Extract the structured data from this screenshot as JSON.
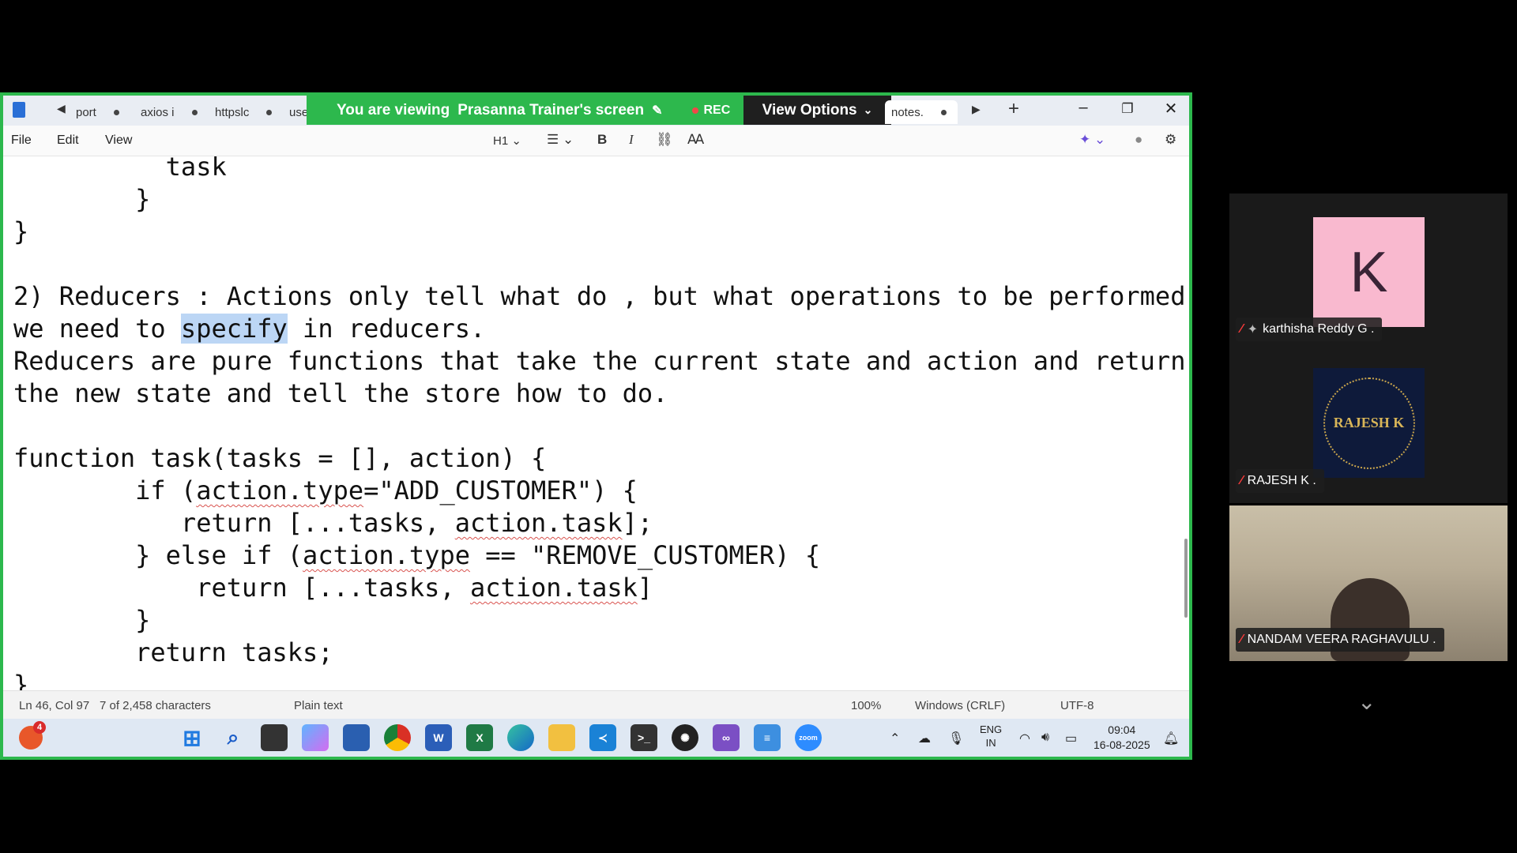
{
  "banner": {
    "viewing_text": "You are viewing",
    "presenter": "Prasanna Trainer's screen",
    "rec_label": "REC",
    "view_options": "View Options"
  },
  "tabs": [
    {
      "label": "port"
    },
    {
      "label": "axios i"
    },
    {
      "label": "httpslc"
    },
    {
      "label": "use"
    },
    {
      "label": "notes."
    }
  ],
  "menu": {
    "file": "File",
    "edit": "Edit",
    "view": "View"
  },
  "format": {
    "heading": "H1"
  },
  "editor_lines": [
    "          task",
    "        }",
    "}",
    "",
    "2) Reducers : Actions only tell what do , but what operations to be performed",
    "we need to specify in reducers.",
    "Reducers are pure functions that take the current state and action and return",
    "the new state and tell the store how to do.",
    "",
    "function task(tasks = [], action) {",
    "        if (action.type=\"ADD_CUSTOMER\") {",
    "           return [...tasks, action.task];",
    "        } else if (action.type == \"REMOVE_CUSTOMER) {",
    "            return [...tasks, action.task]",
    "        }",
    "        return tasks;",
    "}"
  ],
  "status": {
    "position": "Ln 46, Col 97",
    "selection": "7 of 2,458 characters",
    "file_type": "Plain text",
    "zoom": "100%",
    "line_ending": "Windows (CRLF)",
    "encoding": "UTF-8"
  },
  "taskbar": {
    "badge": "4",
    "zoom_label": "zoom",
    "lang": "ENG",
    "region": "IN",
    "time": "09:04",
    "date": "16-08-2025"
  },
  "participants": [
    {
      "name": "karthisha Reddy G .",
      "initial": "K"
    },
    {
      "name": "RAJESH K .",
      "logo_text": "RAJESH K"
    },
    {
      "name": "NANDAM VEERA RAGHAVULU ."
    }
  ],
  "colors": {
    "share_border": "#2db84d",
    "mute": "#ff3b3b",
    "avatar_pink": "#f9b9cf"
  }
}
